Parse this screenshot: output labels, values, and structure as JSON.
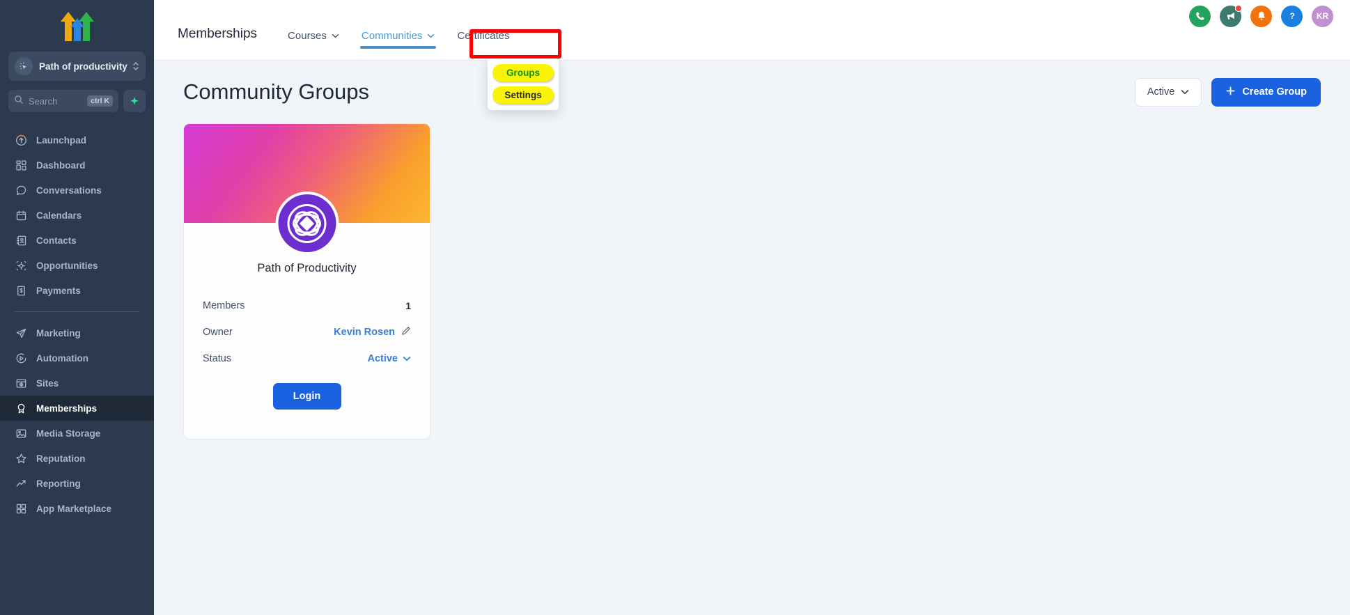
{
  "sidebar": {
    "logo_icon": "three-arrows-logo",
    "workspace": {
      "icon": "cursor-click-icon",
      "label": "Path of productivity",
      "caret_icon": "chevron-updown-icon"
    },
    "search": {
      "icon": "search-icon",
      "placeholder": "Search",
      "shortcut": "ctrl K",
      "spark_icon": "sparkle-icon"
    },
    "items": [
      {
        "label": "Launchpad",
        "icon": "rocket-launch-icon",
        "active": false
      },
      {
        "label": "Dashboard",
        "icon": "dashboard-grid-icon",
        "active": false
      },
      {
        "label": "Conversations",
        "icon": "chat-bubble-icon",
        "active": false
      },
      {
        "label": "Calendars",
        "icon": "calendar-icon",
        "active": false
      },
      {
        "label": "Contacts",
        "icon": "contacts-book-icon",
        "active": false
      },
      {
        "label": "Opportunities",
        "icon": "opportunities-icon",
        "active": false
      },
      {
        "label": "Payments",
        "icon": "payments-bill-icon",
        "active": false
      }
    ],
    "items2": [
      {
        "label": "Marketing",
        "icon": "paper-plane-icon",
        "active": false
      },
      {
        "label": "Automation",
        "icon": "play-circle-icon",
        "active": false
      },
      {
        "label": "Sites",
        "icon": "browser-window-icon",
        "active": false
      },
      {
        "label": "Memberships",
        "icon": "award-ribbon-icon",
        "active": true
      },
      {
        "label": "Media Storage",
        "icon": "image-picture-icon",
        "active": false
      },
      {
        "label": "Reputation",
        "icon": "star-icon",
        "active": false
      },
      {
        "label": "Reporting",
        "icon": "trend-up-icon",
        "active": false
      },
      {
        "label": "App Marketplace",
        "icon": "apps-grid-icon",
        "active": false
      }
    ]
  },
  "topbar": {
    "section_title": "Memberships",
    "tabs": [
      {
        "label": "Courses",
        "has_caret": true,
        "active": false
      },
      {
        "label": "Communities",
        "has_caret": true,
        "active": true
      },
      {
        "label": "Certificates",
        "has_caret": false,
        "active": false
      }
    ],
    "actions": [
      {
        "name": "phone-icon",
        "color": "#22a45d",
        "badge": false
      },
      {
        "name": "megaphone-icon",
        "color": "#3f7a6e",
        "badge": true
      },
      {
        "name": "bell-icon",
        "color": "#f4720b",
        "badge": false
      },
      {
        "name": "help-icon",
        "color": "#1b7fe0",
        "badge": false
      }
    ],
    "avatar": {
      "initials": "KR",
      "color": "#c28fd0"
    }
  },
  "dropdown": {
    "open_for": "Communities",
    "items": [
      {
        "label": "Groups",
        "text_color": "#119419"
      },
      {
        "label": "Settings",
        "text_color": "#2b2b20"
      }
    ]
  },
  "page": {
    "title": "Community Groups",
    "filter": {
      "label": "Active",
      "caret_icon": "chevron-down-icon"
    },
    "create_button": {
      "label": "Create Group",
      "icon": "plus-icon"
    }
  },
  "card": {
    "name": "Path of Productivity",
    "logo_icon": "interlocking-circles-logo",
    "rows": [
      {
        "label": "Members",
        "value": "1",
        "type": "value"
      },
      {
        "label": "Owner",
        "value": "Kevin Rosen",
        "type": "link",
        "edit_icon": "pencil-icon"
      },
      {
        "label": "Status",
        "value": "Active",
        "type": "select",
        "caret_icon": "chevron-down-icon"
      }
    ],
    "login_button": {
      "label": "Login"
    }
  },
  "colors": {
    "sidebar_bg": "#2c3a4f",
    "page_bg": "#f1f5f9",
    "primary_blue": "#1b62e0",
    "tab_active": "#4b9ad4",
    "annotation_red": "#fb0000",
    "highlight_yellow": "#fbf305"
  }
}
